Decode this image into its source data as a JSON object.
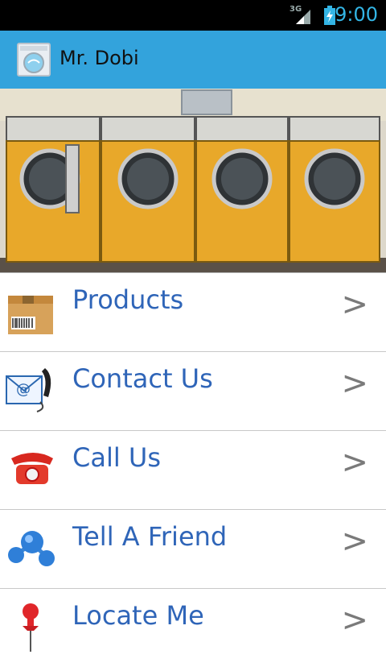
{
  "status_bar": {
    "network": "3G",
    "time": "9:00"
  },
  "app_bar": {
    "title": "Mr. Dobi",
    "icon": "washing-machine-icon"
  },
  "hero": {
    "description_icon": "laundromat-photo"
  },
  "menu": {
    "items": [
      {
        "label": "Products",
        "icon": "package-box-icon",
        "arrow": ">"
      },
      {
        "label": "Contact Us",
        "icon": "email-phone-icon",
        "arrow": ">"
      },
      {
        "label": "Call Us",
        "icon": "red-telephone-icon",
        "arrow": ">"
      },
      {
        "label": "Tell A Friend",
        "icon": "share-molecule-icon",
        "arrow": ">"
      },
      {
        "label": "Locate Me",
        "icon": "map-pin-icon",
        "arrow": ">"
      }
    ]
  },
  "colors": {
    "app_bar": "#33a3dc",
    "status_accent": "#33b5e5",
    "label": "#2f65b8",
    "washer": "#e8a82a"
  }
}
